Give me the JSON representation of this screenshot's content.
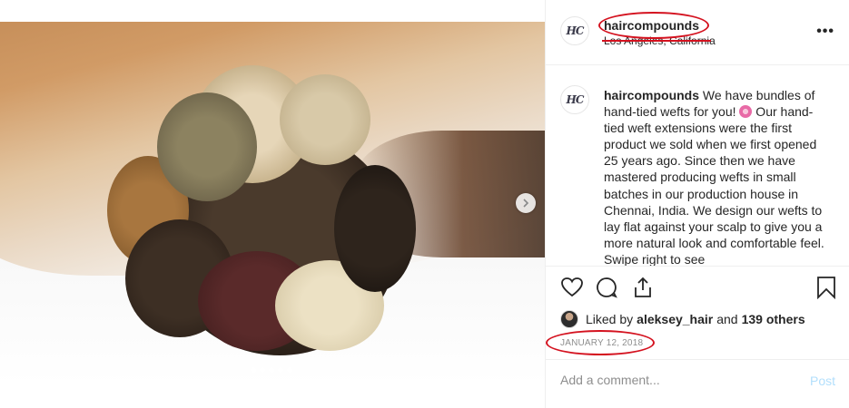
{
  "post": {
    "username": "haircompounds",
    "location": "Los Angeles, California",
    "avatar_text": "HC",
    "caption_username": "haircompounds",
    "caption_part1": " We have bundles of hand-tied wefts for you! ",
    "caption_part2": " Our hand-tied weft extensions were the first product we sold when we first opened 25 years ago. Since then we have mastered producing wefts in small batches in our production house in Chennai, India. We design our wefts to lay flat against your scalp to give you a more natural look and comfortable feel. Swipe right to see",
    "liked_by_label": "Liked by",
    "liked_by_user": "aleksey_hair",
    "and_label": "and",
    "others_label": "139 others",
    "date": "JANUARY 12, 2018"
  },
  "comment": {
    "placeholder": "Add a comment...",
    "post_label": "Post"
  },
  "carousel": {
    "slides": 5,
    "active_index": 0
  },
  "icons": [
    "more-icon",
    "heart-icon",
    "comment-icon",
    "share-icon",
    "bookmark-icon",
    "chevron-right-icon",
    "flower-emoji-icon"
  ],
  "colors": {
    "annotation": "#d4121f",
    "post_button": "#b2dffc",
    "muted": "#8e8e8e"
  }
}
